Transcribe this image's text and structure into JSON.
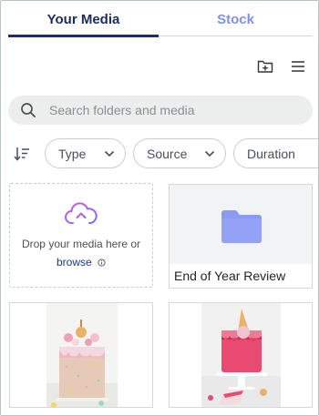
{
  "tabs": [
    {
      "label": "Your Media",
      "active": true
    },
    {
      "label": "Stock",
      "active": false
    }
  ],
  "toolbar": {
    "new_folder_icon": "folder-plus-icon",
    "menu_icon": "hamburger-menu-icon"
  },
  "search": {
    "placeholder": "Search folders and media",
    "value": ""
  },
  "filters": {
    "sort_icon": "sort-icon",
    "chips": [
      {
        "label": "Type"
      },
      {
        "label": "Source"
      },
      {
        "label": "Duration"
      }
    ]
  },
  "upload": {
    "text": "Drop your media here or",
    "browse_label": "browse"
  },
  "folder": {
    "name": "End of Year Review"
  },
  "colors": {
    "accent": "#1d2e6b",
    "inactive_tab": "#8090e0",
    "folder": "#8b9bf5"
  }
}
